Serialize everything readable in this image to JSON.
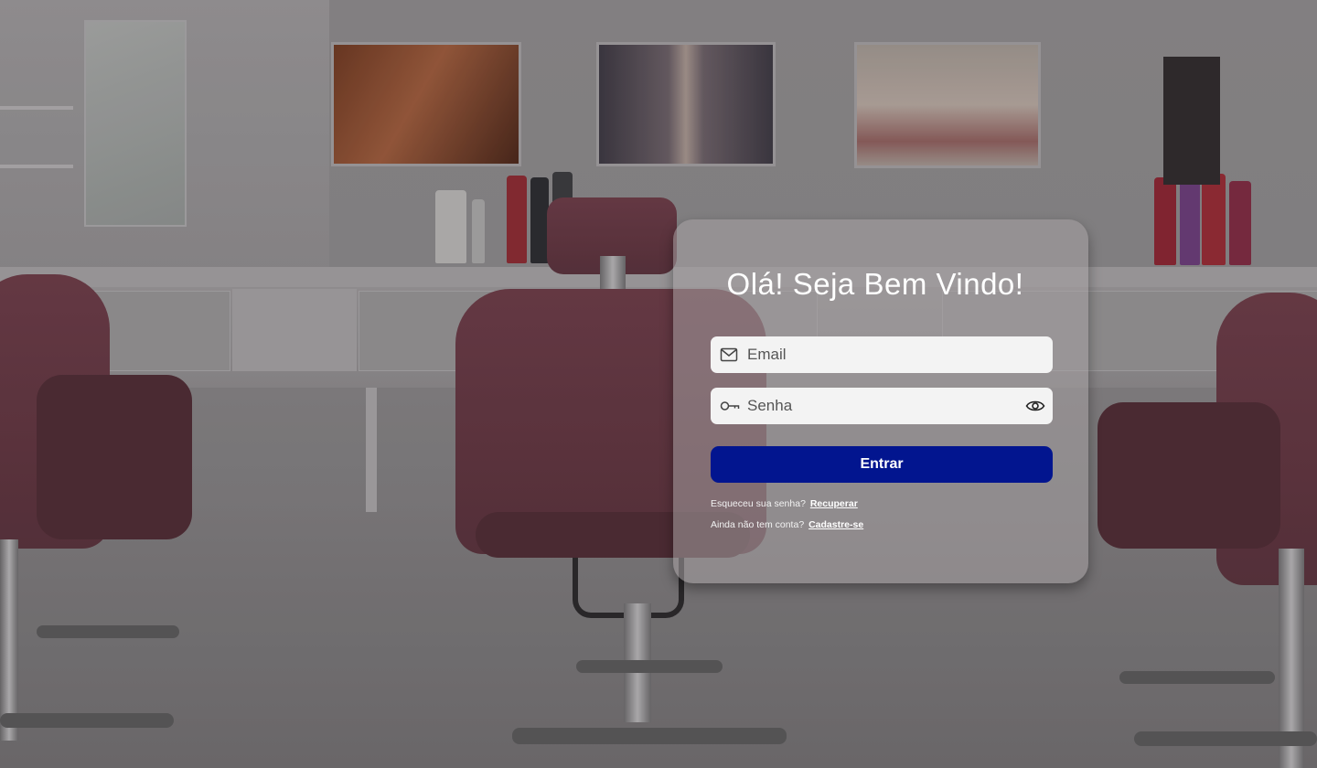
{
  "login": {
    "title": "Olá! Seja Bem Vindo!",
    "email": {
      "placeholder": "Email",
      "value": "",
      "icon": "mail-icon"
    },
    "password": {
      "placeholder": "Senha",
      "value": "",
      "icon": "key-icon",
      "toggle_icon": "eye-icon"
    },
    "submit_label": "Entrar",
    "forgot": {
      "text": "Esqueceu sua senha?",
      "link": "Recuperar"
    },
    "signup": {
      "text": "Ainda não tem conta?",
      "link": "Cadastre-se"
    }
  },
  "colors": {
    "primary_button": "#02158f",
    "card_background": "rgba(165,160,162,0.55)",
    "text_on_card": "#ffffff"
  }
}
